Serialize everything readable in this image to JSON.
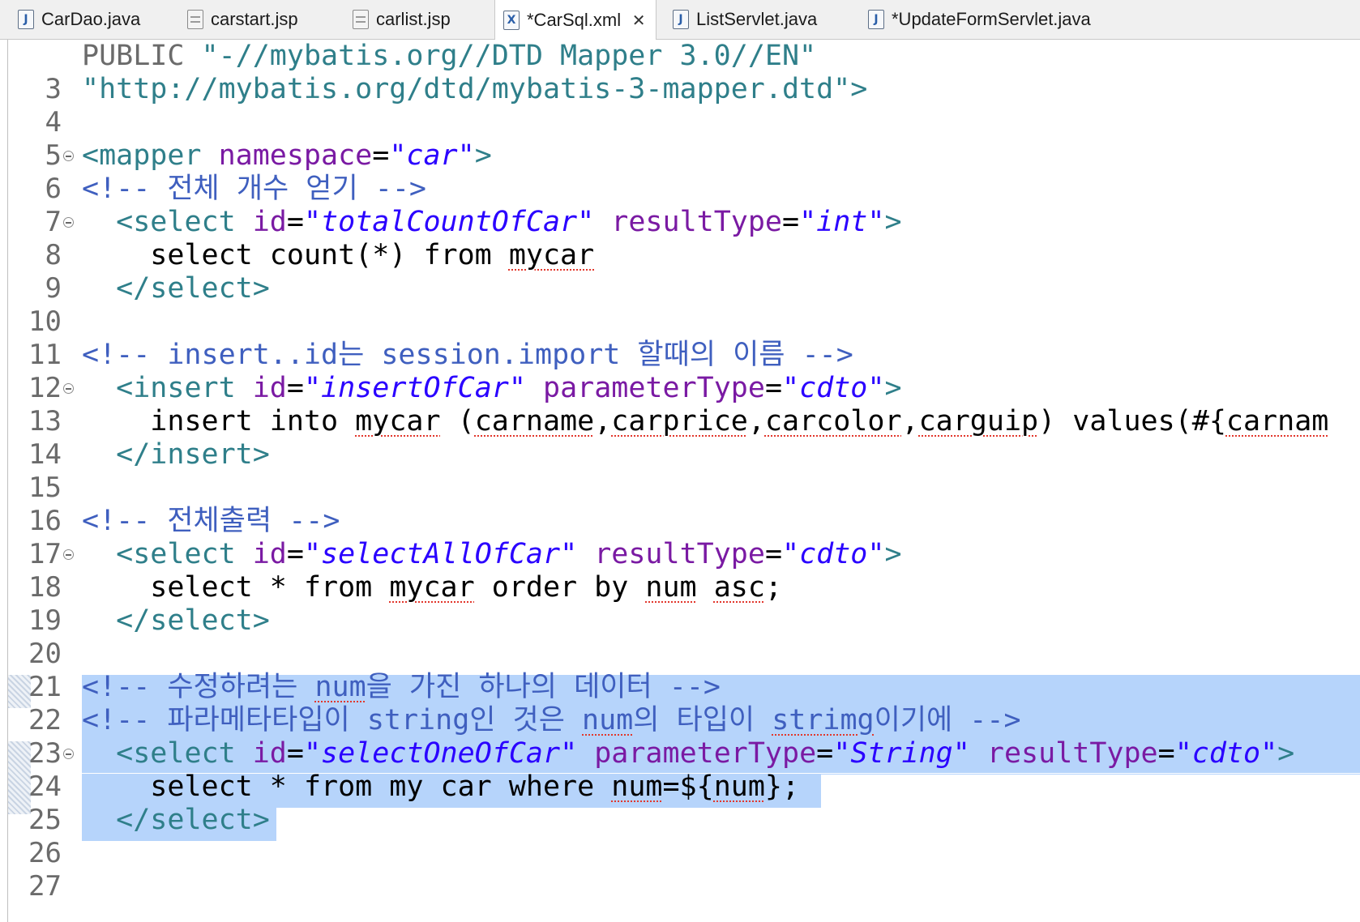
{
  "tabs": [
    {
      "label": "CarDao.java",
      "icon": "java-file-icon",
      "active": false
    },
    {
      "label": "carstart.jsp",
      "icon": "jsp-file-icon",
      "active": false
    },
    {
      "label": "carlist.jsp",
      "icon": "jsp-file-icon",
      "active": false
    },
    {
      "label": "*CarSql.xml",
      "icon": "xml-file-icon",
      "active": true
    },
    {
      "label": "ListServlet.java",
      "icon": "java-file-icon",
      "active": false
    },
    {
      "label": "*UpdateFormServlet.java",
      "icon": "java-file-icon",
      "active": false
    }
  ],
  "icon_letters": {
    "java": "J",
    "xml": "X"
  },
  "close_glyph": "✕",
  "line_numbers": [
    "3",
    "4",
    "5",
    "6",
    "7",
    "8",
    "9",
    "10",
    "11",
    "12",
    "13",
    "14",
    "15",
    "16",
    "17",
    "18",
    "19",
    "20",
    "21",
    "22",
    "23",
    "24",
    "25",
    "26",
    "27"
  ],
  "code": {
    "l3": {
      "kw": "PUBLIC ",
      "str": "\"-//mybatis.org//DTD Mapper 3.0//EN\""
    },
    "l4": {
      "str": "\"http://mybatis.org/dtd/mybatis-3-mapper.dtd\">"
    },
    "l6": {
      "open": "<mapper ",
      "attr": "namespace",
      "eq": "=",
      "q1": "\"",
      "val": "car",
      "q2": "\"",
      "close": ">"
    },
    "l7": {
      "comment": "<!-- 전체 개수 얻기 -->"
    },
    "l8": {
      "indent": "  ",
      "open": "<select ",
      "a1": "id",
      "eq1": "=",
      "v1": "totalCountOfCar",
      "a2": "resultType",
      "eq2": "=",
      "v2": "int",
      "close": ">"
    },
    "l9": {
      "indent": "    ",
      "text": "select count(*) from ",
      "sp": "mycar"
    },
    "l10": {
      "indent": "  ",
      "close": "</select>"
    },
    "l12": {
      "comment": "<!-- insert..id는 session.import 할때의 이름 -->"
    },
    "l13": {
      "indent": "  ",
      "open": "<insert ",
      "a1": "id",
      "eq1": "=",
      "v1": "insertOfCar",
      "a2": "parameterType",
      "eq2": "=",
      "v2": "cdto",
      "close": ">"
    },
    "l14": {
      "indent": "    ",
      "t1": "insert into ",
      "s1": "mycar",
      "t2": " (",
      "s2": "carname",
      "t3": ",",
      "s3": "carprice",
      "t4": ",",
      "s4": "carcolor",
      "t5": ",",
      "s5": "carguip",
      "t6": ") values(#{",
      "s6": "carnam"
    },
    "l15": {
      "indent": "  ",
      "close": "</insert>"
    },
    "l17": {
      "comment": "<!-- 전체출력 -->"
    },
    "l18": {
      "indent": "  ",
      "open": "<select ",
      "a1": "id",
      "eq1": "=",
      "v1": "selectAllOfCar",
      "a2": "resultType",
      "eq2": "=",
      "v2": "cdto",
      "close": ">"
    },
    "l19": {
      "indent": "    ",
      "t1": "select * from ",
      "s1": "mycar",
      "t2": " order by ",
      "s2": "num",
      "t3": " ",
      "s3": "asc",
      "t4": ";"
    },
    "l20": {
      "indent": "  ",
      "close": "</select>"
    },
    "l22": {
      "c1": "<!-- 수정하려는 ",
      "s1": "num",
      "c2": "을 가진 하나의 데이터 -->"
    },
    "l23": {
      "c1": "<!-- 파라메타타입이 string인 것은 ",
      "s1": "num",
      "c2": "의 타입이 ",
      "s2": "strimg",
      "c3": "이기에 -->"
    },
    "l24": {
      "indent": "  ",
      "open": "<select ",
      "a1": "id",
      "eq1": "=",
      "v1": "selectOneOfCar",
      "a2": "parameterType",
      "eq2": "=",
      "v2": "String",
      "a3": "resultType",
      "eq3": "=",
      "v3": "cdto",
      "close": ">"
    },
    "l25": {
      "indent": "    ",
      "t1": "select * from my car where ",
      "s1": "num",
      "t2": "=${",
      "s2": "num",
      "t3": "};"
    },
    "l26": {
      "indent": "  ",
      "close": "</select>"
    }
  }
}
